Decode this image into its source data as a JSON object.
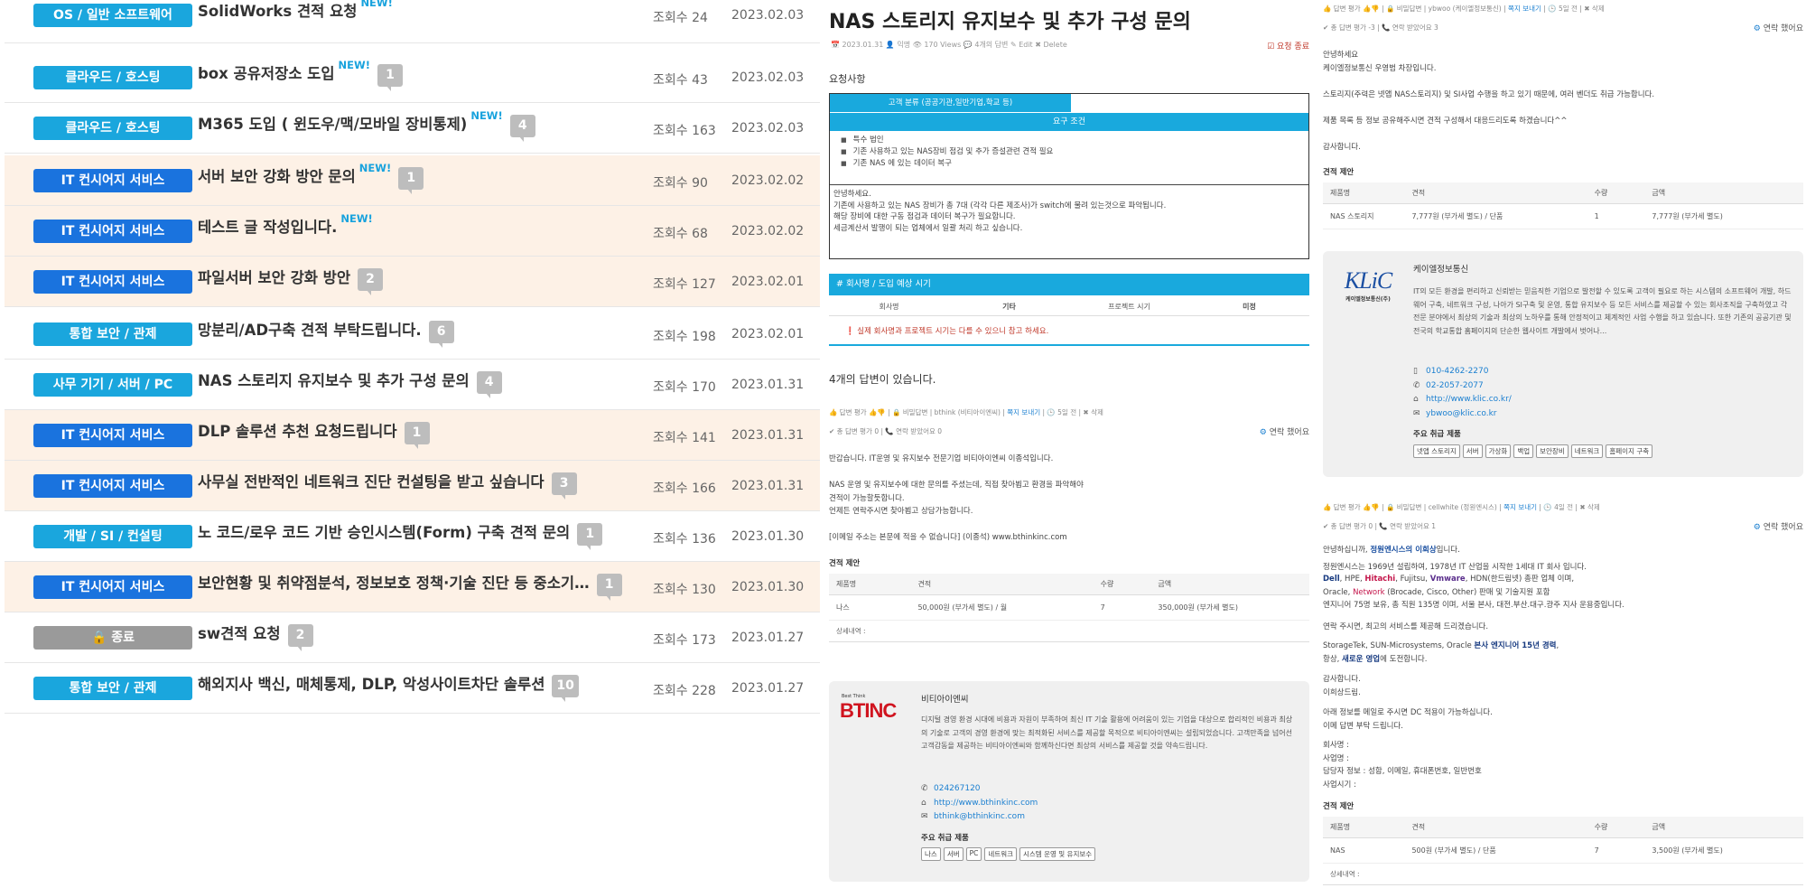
{
  "list": {
    "rows": [
      {
        "category": "OS / 일반 소프트웨어",
        "title": "SolidWorks 견적 요청",
        "new": "NEW!",
        "comments": "",
        "views": "조회수 24",
        "date": "2023.02.03"
      },
      {
        "category": "클라우드 / 호스팅",
        "title": "box 공유저장소 도입",
        "new": "NEW!",
        "comments": "1",
        "views": "조회수 43",
        "date": "2023.02.03"
      },
      {
        "category": "클라우드 / 호스팅",
        "title": "M365 도입 ( 윈도우/맥/모바일 장비통제)",
        "new": "NEW!",
        "comments": "4",
        "views": "조회수 163",
        "date": "2023.02.03"
      },
      {
        "category": "IT 컨시어지 서비스",
        "title": "서버 보안 강화 방안 문의",
        "new": "NEW!",
        "comments": "1",
        "views": "조회수 90",
        "date": "2023.02.02"
      },
      {
        "category": "IT 컨시어지 서비스",
        "title": "테스트 글 작성입니다.",
        "new": "NEW!",
        "comments": "",
        "views": "조회수 68",
        "date": "2023.02.02"
      },
      {
        "category": "IT 컨시어지 서비스",
        "title": "파일서버 보안 강화 방안",
        "new": "",
        "comments": "2",
        "views": "조회수 127",
        "date": "2023.02.01"
      },
      {
        "category": "통합 보안 / 관제",
        "title": "망분리/AD구축 견적 부탁드립니다.",
        "new": "",
        "comments": "6",
        "views": "조회수 198",
        "date": "2023.02.01"
      },
      {
        "category": "사무 기기 / 서버 / PC",
        "title": "NAS 스토리지 유지보수 및 추가 구성 문의",
        "new": "",
        "comments": "4",
        "views": "조회수 170",
        "date": "2023.01.31"
      },
      {
        "category": "IT 컨시어지 서비스",
        "title": "DLP 솔루션 추천 요청드립니다",
        "new": "",
        "comments": "1",
        "views": "조회수 141",
        "date": "2023.01.31"
      },
      {
        "category": "IT 컨시어지 서비스",
        "title": "사무실 전반적인 네트워크 진단 컨설팅을 받고 싶습니다",
        "new": "",
        "comments": "3",
        "views": "조회수 166",
        "date": "2023.01.31"
      },
      {
        "category": "개발 / SI / 컨설팅",
        "title": "노 코드/로우 코드 기반 승인시스템(Form) 구축 견적 문의",
        "new": "",
        "comments": "1",
        "views": "조회수 136",
        "date": "2023.01.30"
      },
      {
        "category": "IT 컨시어지 서비스",
        "title": "보안현황 및 취약점분석, 정보보호 정책·기술 진단 등 중소기…",
        "new": "",
        "comments": "1",
        "views": "조회수 130",
        "date": "2023.01.30"
      },
      {
        "category": "🔒 종료",
        "title": "sw견적 요청",
        "new": "",
        "comments": "2",
        "views": "조회수 173",
        "date": "2023.01.27"
      },
      {
        "category": "통합 보안 / 관제",
        "title": "해외지사 백신, 매체통제, DLP, 악성사이트차단 솔루션",
        "new": "",
        "comments": "10",
        "views": "조회수 228",
        "date": "2023.01.27"
      }
    ]
  },
  "post": {
    "title": "NAS 스토리지 유지보수 및 추가 구성 문의",
    "meta": "📅 2023.01.31   👤 익명   👁 170 Views   💬 4개의 답변   ✎ Edit   ✖ Delete",
    "status": "☑ 요청 종료",
    "section": "요청사항",
    "customer_class_header": "고객 분류 (공공기관,일반기업,학교 등)",
    "requirements_header": "요구 조건",
    "requirements": [
      "특수 법인",
      "기존 사용하고 있는 NAS장비 점검 및 추가 증설관련 견적 필요",
      "기존 NAS 에 있는 데이터 복구"
    ],
    "body": [
      "안녕하세요.",
      "기존에 사용하고 있는 NAS 장비가 총 7대 (각각 다른 제조사)가 switch에 물려 있는것으로 파악됩니다.",
      "해당 장비에 대한 구동 점검과 데이터 복구가 필요합니다.",
      "세금계산서 발행이 되는 업체에서 일괄 처리 하고 싶습니다."
    ],
    "intro_header": "# 회사명 / 도입 예상 시기",
    "intro_grid": [
      "회사명",
      "기타",
      "프로젝트 시기",
      "미정"
    ],
    "intro_warning": "❗ 실제 회사명과 프로젝트 시기는 다를 수 있으니 참고 하세요.",
    "answer_count": "4개의 답변이 있습니다."
  },
  "answer1": {
    "line1_pre": "👍 답변 평가 👍👎 | 🔒 비밀답변 | bthink (비티아이엔씨) | ",
    "line1_link": "쪽지 보내기",
    "line1_post": " | 🕒 5일 전 | ✖ 삭제",
    "line2": "✔ 총 답변 평가 0 | 📞 연락 받았어요 0",
    "contact": "연락 했어요",
    "body": [
      "반갑습니다.  IT운영 및 유지보수 전문기업 비티아이엔씨 이종석입니다.",
      "",
      "NAS 운영 및 유지보수에 대한 문의를 주셨는데, 직접 찾아뵙고 환경을 파악해야",
      "견적이 가능할듯합니다.",
      "언제든 연락주시면 찾아뵙고 상담가능합니다.",
      "",
      "[이메일 주소는 본문에 적을 수 없습니다]   (이종석)        www.bthinkinc.com"
    ],
    "quote_label": "견적 제안",
    "quote_headers": [
      "제품명",
      "견적",
      "수량",
      "금액"
    ],
    "quote_row": [
      "나스",
      "50,000원 (부가세 별도) / 월",
      "7",
      "350,000원 (부가세 별도)"
    ],
    "detail_label": "상세내역 :"
  },
  "vendor1": {
    "logo_small": "Best Think",
    "logo_text": "BTINC",
    "name": "비티아이엔씨",
    "desc": "디지털 경영 환경 시대에 비용과 자원이 부족하여 최신 IT 기술 활용에 어려움이 있는 기업을 대상으로 합리적인 비용과 최상의 기술로 고객의 경영 환경에 맞는 최적화된 서비스를 제공할 목적으로 비티아이엔씨는 설립되었습니다. 고객만족을 넘어선 고객감동을 제공하는 비티아이엔씨와 함께하신다면 최상의 서비스를 제공할 것을 약속드립니다.",
    "phone1": "024267120",
    "web": "http://www.bthinkinc.com",
    "email": "bthink@bthinkinc.com",
    "products_label": "주요 취급 제품",
    "tags": [
      "나스",
      "서버",
      "PC",
      "네트워크",
      "시스템 운영 및 유지보수"
    ]
  },
  "answer_top": {
    "line1_pre": "👍 답변 평가 👍👎 | 🔒 비밀답변 | ybwoo (케이엘정보통신) | ",
    "line1_link": "쪽지 보내기",
    "line1_post": " | 🕒 5일 전 | ✖ 삭제",
    "line2": "✔ 총 답변 평가 -3 | 📞 연락 받았어요 3",
    "contact": "연락 했어요",
    "body": [
      "안녕하세요",
      "케이엘정보통신 우영범 차장입니다.",
      "",
      "스토리지(주력은 넷앱 NAS스토리지) 및 SI사업 수행을 하고 있기 때문에, 여러 벤더도 취급 가능합니다.",
      "",
      "제품 목록 등 정보 공유해주시면 견적 구성해서 대응드리도록 하겠습니다^^",
      "",
      "감사합니다."
    ],
    "quote_label": "견적 제안",
    "quote_headers": [
      "제품명",
      "견적",
      "수량",
      "금액"
    ],
    "quote_row": [
      "NAS 스토리지",
      "7,777원 (부가세 별도) / 단품",
      "1",
      "7,777원 (부가세 별도)"
    ]
  },
  "vendor2": {
    "logo_text": "KLiC",
    "logo_sub": "케이엘정보통신(주)",
    "name": "케이엘정보통신",
    "desc": "IT의 모든 환경을 편리하고 신뢰받는 믿음직한 기업으로 발전할 수 있도록 고객이 필요로 하는 시스템의 소프트웨어 개발, 하드웨어 구축, 네트워크 구성, 나아가 SI구축 및 운영, 통합 유지보수 등 모든 서비스를 제공할 수 있는 회사조직을 구축하였고 각 전문 분야에서 최상의 기술과 최상의 노하우를 통해 안정적이고 체계적인 사업 수행을 하고 있습니다. 또한 기존의 공공기관 및 전국의 학교통합 홈페이지의 단순한 웹사이트 개발에서 벗어나...",
    "phone1": "010-4262-2270",
    "phone2": "02-2057-2077",
    "web": "http://www.klic.co.kr/",
    "email": "ybwoo@klic.co.kr",
    "products_label": "주요 취급 제품",
    "tags": [
      "넷앱 스토리지",
      "서버",
      "가상화",
      "백업",
      "보안장비",
      "네트워크",
      "홈페이지 구축"
    ]
  },
  "answer3": {
    "line1_pre": "👍 답변 평가 👍👎 | 🔒 비밀답변 | cellwhite (정원엔시스) | ",
    "line1_link": "쪽지 보내기",
    "line1_post": " | 🕒 4일 전 | ✖ 삭제",
    "line2": "✔ 총 답변 평가 0 | 📞 연락 받았어요 1",
    "contact": "연락 했어요",
    "greet_pre": "안녕하십니까, ",
    "greet_hl": "정원엔시스의 이희상",
    "greet_post": "입니다.",
    "p1": "정원엔시스는 1969년 설립하여, 1978년 IT 산업을 시작한 1세대 IT 회사 입니다.",
    "brands_1": "Dell",
    "brands_2": ", HPE, ",
    "brands_3": "Hitachi",
    "brands_4": ", Fujitsu, ",
    "brands_5": "Vmware",
    "brands_6": ", HDN(한드림넷) 총판 업체 이며,",
    "oracle_pre": "Oracle, ",
    "oracle_net": "Network",
    "oracle_post": " (Brocade, Cisco, Other) 판매 및 기술지원 포함",
    "p2": "엔지니어 75명 보유, 총 직원 135명 이며, 서울 본사, 대전.부산.대구.광주 지사 운용중입니다.",
    "p3": "연락 주시면, 최고의 서비스를 제공해 드리겠습니다.",
    "st_pre": "StorageTek, SUN-Microsystems, Oracle ",
    "st_hl": "본사 엔지니어 15년 경력",
    "st_post": ",",
    "always_pre": "항상, ",
    "always_hl": "새로운 영업",
    "always_post": "에 도전합니다.",
    "thanks": [
      "감사합니다.",
      "이희상드림."
    ],
    "p4": [
      "아래 정보를 메일로 주시면 DC 적용이 가능하십니다.",
      "이메 답변 부탁 드립니다."
    ],
    "fields": [
      "회사명 :",
      "사업명 :",
      "담당자 정보 : 성함, 이메일, 휴대폰번호, 일반번호",
      "사업시기 :"
    ],
    "quote_label": "견적 제안",
    "quote_headers": [
      "제품명",
      "견적",
      "수량",
      "금액"
    ],
    "quote_row": [
      "NAS",
      "500원 (부가세 별도) / 단품",
      "7",
      "3,500원 (부가세 별도)"
    ],
    "detail_label": "상세내역 :"
  }
}
